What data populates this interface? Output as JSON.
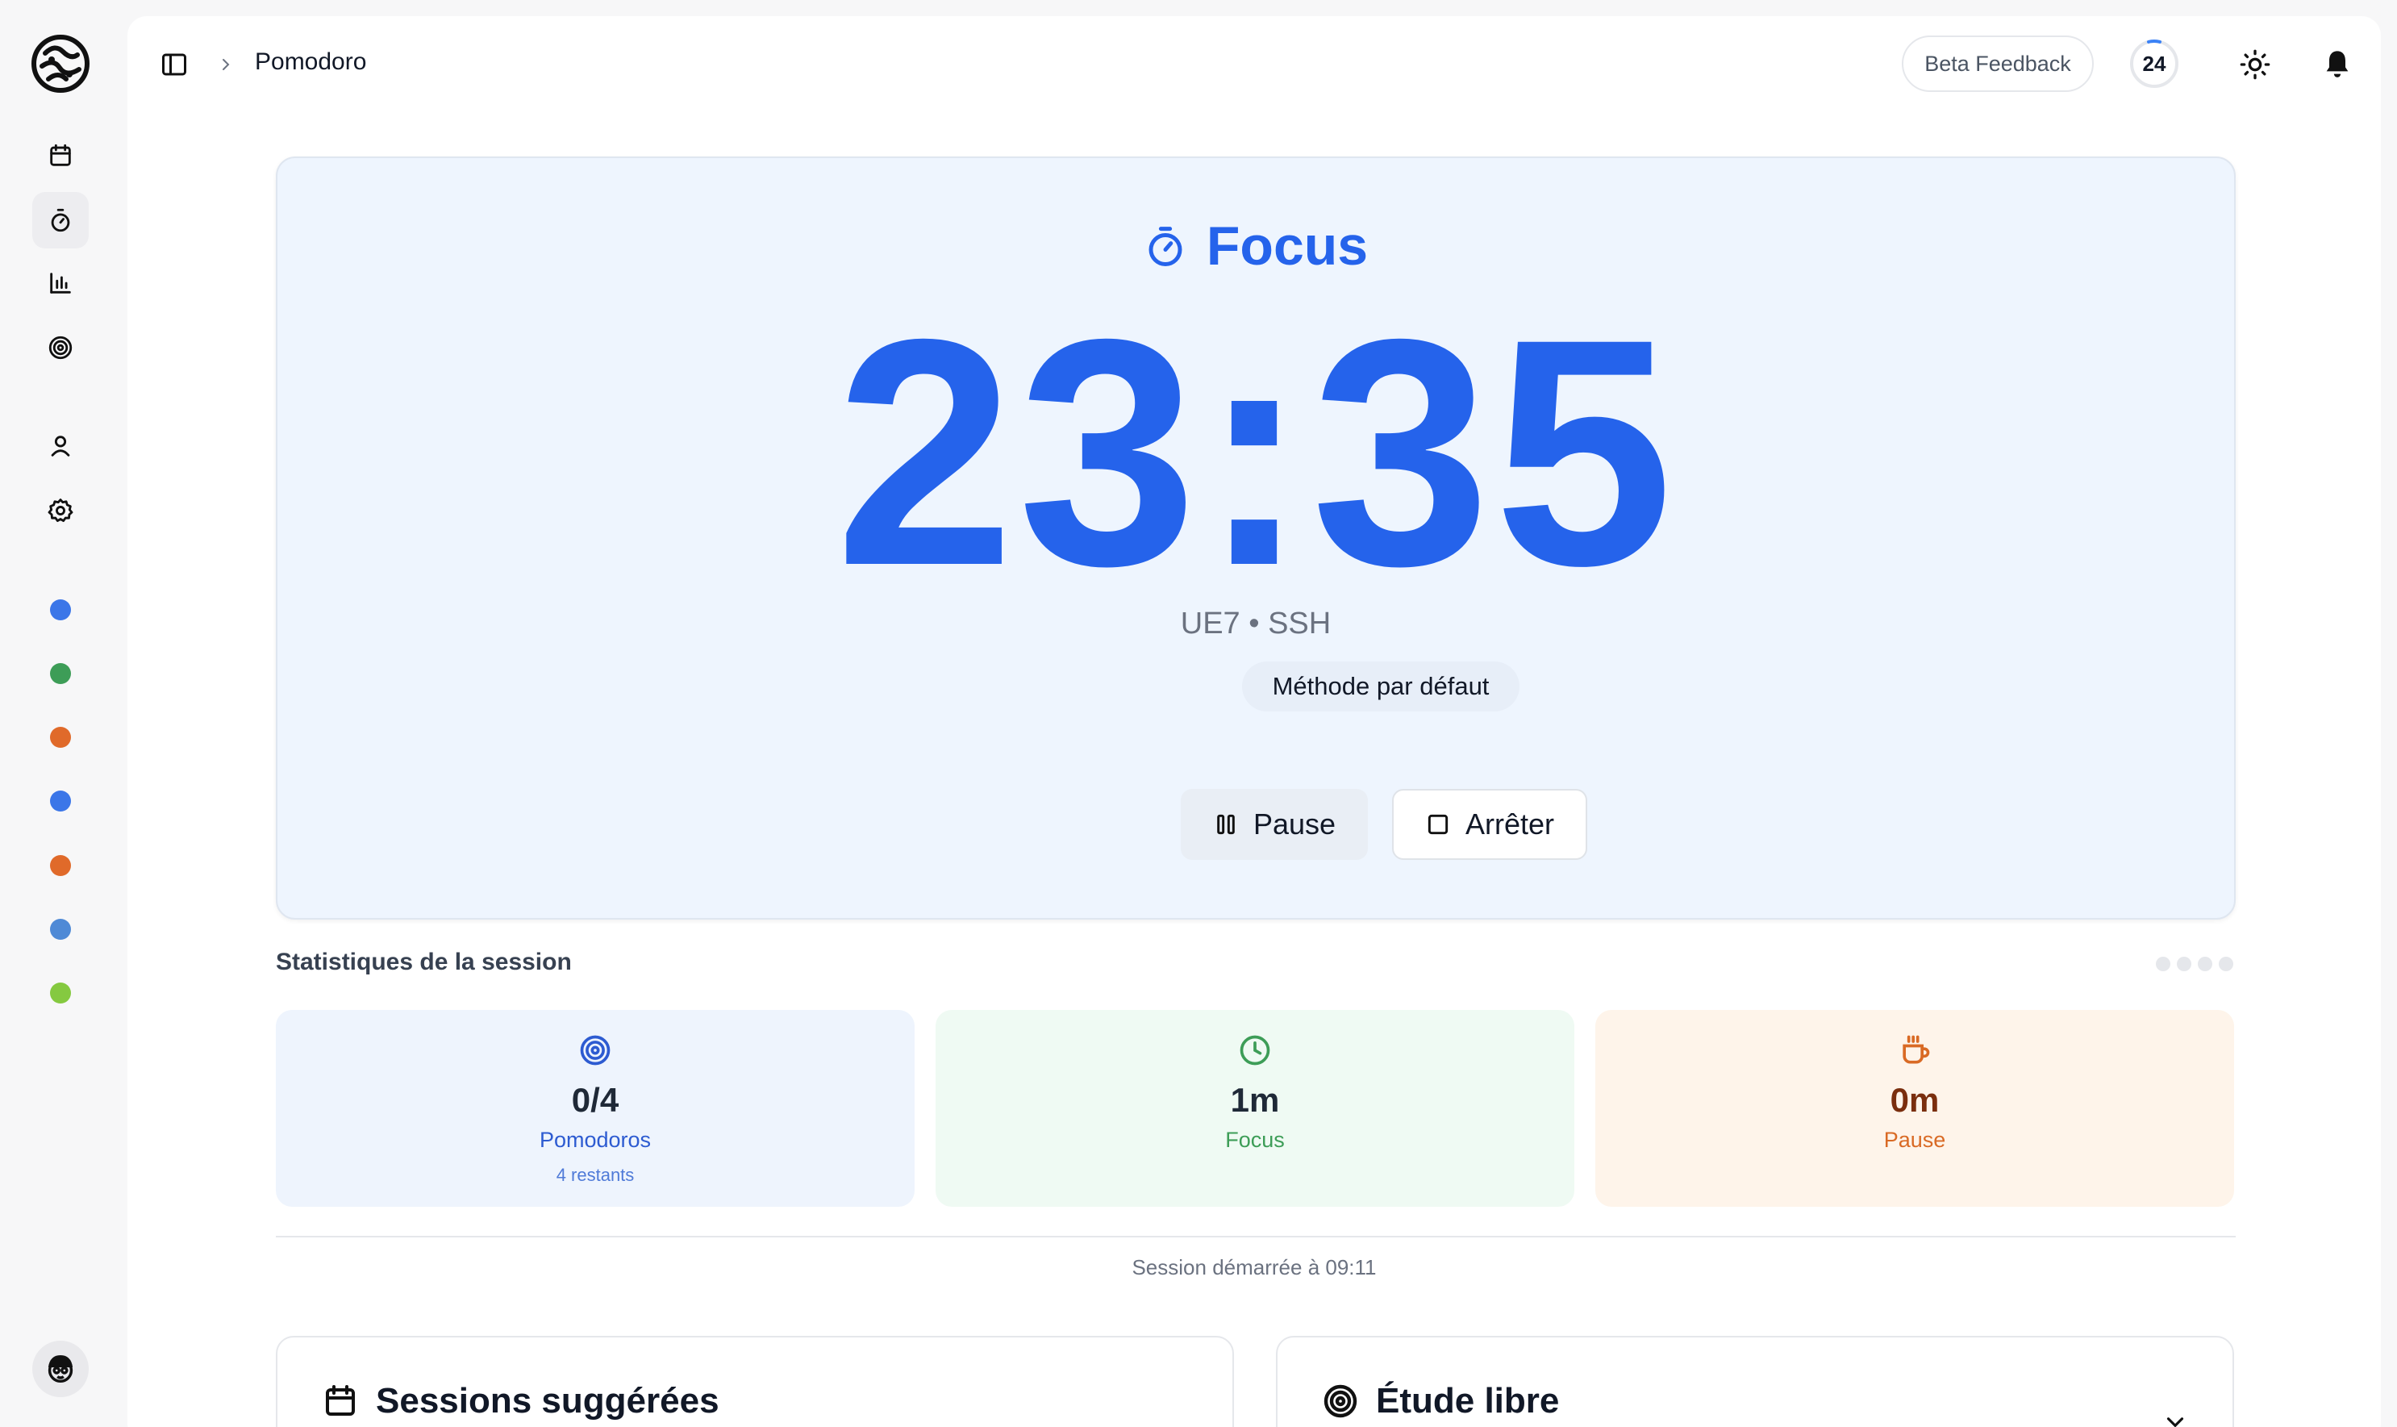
{
  "header": {
    "breadcrumb_title": "Pomodoro",
    "beta_feedback_label": "Beta Feedback",
    "count_badge": "24"
  },
  "sidebar": {
    "nav_icons": [
      "calendar-icon",
      "timer-icon",
      "chart-icon",
      "target-icon",
      "user-icon",
      "gear-icon"
    ],
    "active_item": "timer-icon",
    "dot_colors": [
      "#3b76e8",
      "#3d9d57",
      "#e06a2a",
      "#3b76e8",
      "#e06a2a",
      "#4f8ad6",
      "#85c940"
    ]
  },
  "timer": {
    "mode": "Focus",
    "time": "23:35",
    "subject": "UE7 • SSH",
    "method": "Méthode par défaut",
    "pause_label": "Pause",
    "stop_label": "Arrêter",
    "accent": "#2563eb"
  },
  "stats": {
    "title": "Statistiques de la session",
    "cards": [
      {
        "value": "0/4",
        "label": "Pomodoros",
        "sub": "4 restants",
        "icon": "target-icon",
        "color": "#2d5bd1"
      },
      {
        "value": "1m",
        "label": "Focus",
        "icon": "clock-icon",
        "color": "#3d9d57"
      },
      {
        "value": "0m",
        "label": "Pause",
        "icon": "coffee-icon",
        "color": "#d96a25"
      }
    ],
    "started_text": "Session démarrée à 09:11"
  },
  "bottom": {
    "suggested_title": "Sessions suggérées",
    "free_study_title": "Étude libre"
  }
}
